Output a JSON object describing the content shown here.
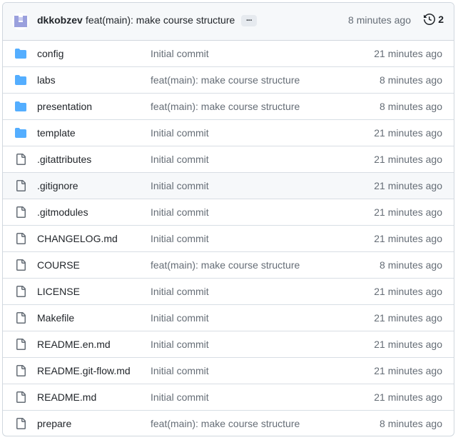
{
  "header": {
    "author": "dkkobzev",
    "message": "feat(main): make course structure",
    "ellipsis": "···",
    "time": "8 minutes ago",
    "history_count": "2"
  },
  "colors": {
    "folder": "#54aeff",
    "file": "#656d76",
    "muted": "#656d76",
    "border": "#d0d7de"
  },
  "rows": [
    {
      "name": "config",
      "type": "folder",
      "message": "Initial commit",
      "time": "21 minutes ago"
    },
    {
      "name": "labs",
      "type": "folder",
      "message": "feat(main): make course structure",
      "time": "8 minutes ago"
    },
    {
      "name": "presentation",
      "type": "folder",
      "message": "feat(main): make course structure",
      "time": "8 minutes ago"
    },
    {
      "name": "template",
      "type": "folder",
      "message": "Initial commit",
      "time": "21 minutes ago"
    },
    {
      "name": ".gitattributes",
      "type": "file",
      "message": "Initial commit",
      "time": "21 minutes ago"
    },
    {
      "name": ".gitignore",
      "type": "file",
      "message": "Initial commit",
      "time": "21 minutes ago"
    },
    {
      "name": ".gitmodules",
      "type": "file",
      "message": "Initial commit",
      "time": "21 minutes ago"
    },
    {
      "name": "CHANGELOG.md",
      "type": "file",
      "message": "Initial commit",
      "time": "21 minutes ago"
    },
    {
      "name": "COURSE",
      "type": "file",
      "message": "feat(main): make course structure",
      "time": "8 minutes ago"
    },
    {
      "name": "LICENSE",
      "type": "file",
      "message": "Initial commit",
      "time": "21 minutes ago"
    },
    {
      "name": "Makefile",
      "type": "file",
      "message": "Initial commit",
      "time": "21 minutes ago"
    },
    {
      "name": "README.en.md",
      "type": "file",
      "message": "Initial commit",
      "time": "21 minutes ago"
    },
    {
      "name": "README.git-flow.md",
      "type": "file",
      "message": "Initial commit",
      "time": "21 minutes ago"
    },
    {
      "name": "README.md",
      "type": "file",
      "message": "Initial commit",
      "time": "21 minutes ago"
    },
    {
      "name": "prepare",
      "type": "file",
      "message": "feat(main): make course structure",
      "time": "8 minutes ago"
    }
  ]
}
